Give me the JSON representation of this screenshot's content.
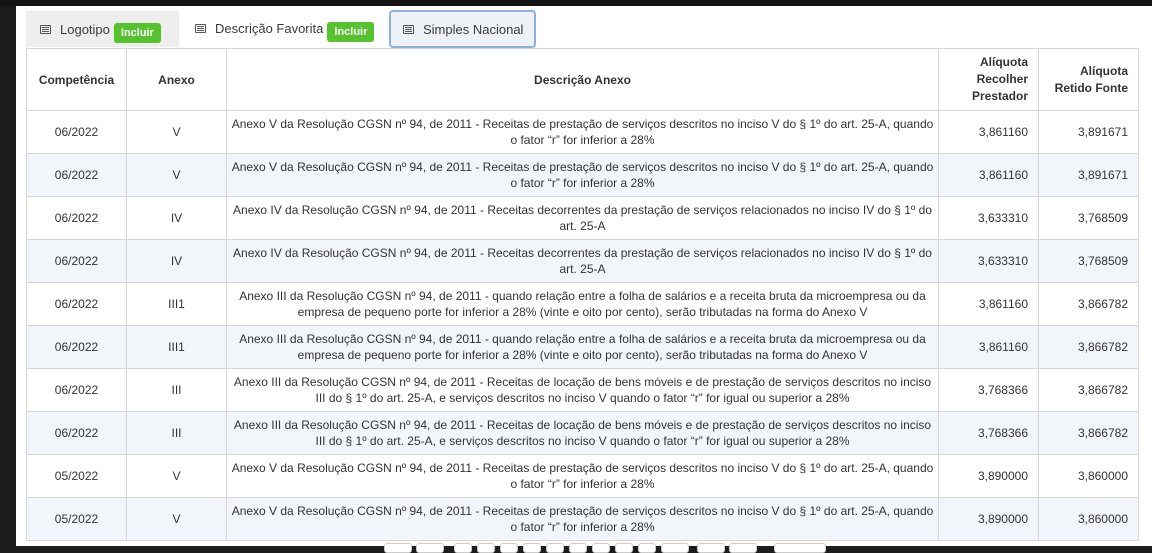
{
  "tabs": [
    {
      "label": "Logotipo",
      "badge": "Incluir"
    },
    {
      "label": "Descrição Favorita",
      "badge": "Incluir"
    },
    {
      "label": "Simples Nacional"
    }
  ],
  "icons": {
    "tab_icon": "list-icon"
  },
  "colors": {
    "badge": "#56c22d",
    "active_tab_border": "#8fb1de",
    "row_alt": "#f2f5f9"
  },
  "table": {
    "headers": [
      "Competência",
      "Anexo",
      "Descrição Anexo",
      "Alíquota Recolher Prestador",
      "Alíquota Retido Fonte"
    ],
    "rows": [
      [
        "06/2022",
        "V",
        "Anexo V da Resolução CGSN nº 94, de 2011 - Receitas de prestação de serviços descritos no inciso V do § 1º do art. 25-A, quando o fator “r” for inferior a 28%",
        "3,861160",
        "3,891671"
      ],
      [
        "06/2022",
        "V",
        "Anexo V da Resolução CGSN nº 94, de 2011 - Receitas de prestação de serviços descritos no inciso V do § 1º do art. 25-A, quando o fator “r” for inferior a 28%",
        "3,861160",
        "3,891671"
      ],
      [
        "06/2022",
        "IV",
        "Anexo IV da Resolução CGSN nº 94, de 2011 - Receitas decorrentes da prestação de serviços relacionados no inciso IV do § 1º do art. 25-A",
        "3,633310",
        "3,768509"
      ],
      [
        "06/2022",
        "IV",
        "Anexo IV da Resolução CGSN nº 94, de 2011 - Receitas decorrentes da prestação de serviços relacionados no inciso IV do § 1º do art. 25-A",
        "3,633310",
        "3,768509"
      ],
      [
        "06/2022",
        "III1",
        "Anexo III da Resolução CGSN nº 94, de 2011 - quando relação entre a folha de salários e a receita bruta da microempresa ou da empresa de pequeno porte for inferior a 28% (vinte e oito por cento), serão tributadas na forma do Anexo V",
        "3,861160",
        "3,866782"
      ],
      [
        "06/2022",
        "III1",
        "Anexo III da Resolução CGSN nº 94, de 2011 - quando relação entre a folha de salários e a receita bruta da microempresa ou da empresa de pequeno porte for inferior a 28% (vinte e oito por cento), serão tributadas na forma do Anexo V",
        "3,861160",
        "3,866782"
      ],
      [
        "06/2022",
        "III",
        "Anexo III da Resolução CGSN nº 94, de 2011 - Receitas de locação de bens móveis e de prestação de serviços descritos no inciso III do § 1º do art. 25-A, e serviços descritos no inciso V quando o fator “r” for igual ou superior a 28%",
        "3,768366",
        "3,866782"
      ],
      [
        "06/2022",
        "III",
        "Anexo III da Resolução CGSN nº 94, de 2011 - Receitas de locação de bens móveis e de prestação de serviços descritos no inciso III do § 1º do art. 25-A, e serviços descritos no inciso V quando o fator “r” for igual ou superior a 28%",
        "3,768366",
        "3,866782"
      ],
      [
        "05/2022",
        "V",
        "Anexo V da Resolução CGSN nº 94, de 2011 - Receitas de prestação de serviços descritos no inciso V do § 1º do art. 25-A, quando o fator “r” for inferior a 28%",
        "3,890000",
        "3,860000"
      ],
      [
        "05/2022",
        "V",
        "Anexo V da Resolução CGSN nº 94, de 2011 - Receitas de prestação de serviços descritos no inciso V do § 1º do art. 25-A, quando o fator “r” for inferior a 28%",
        "3,890000",
        "3,860000"
      ]
    ]
  }
}
